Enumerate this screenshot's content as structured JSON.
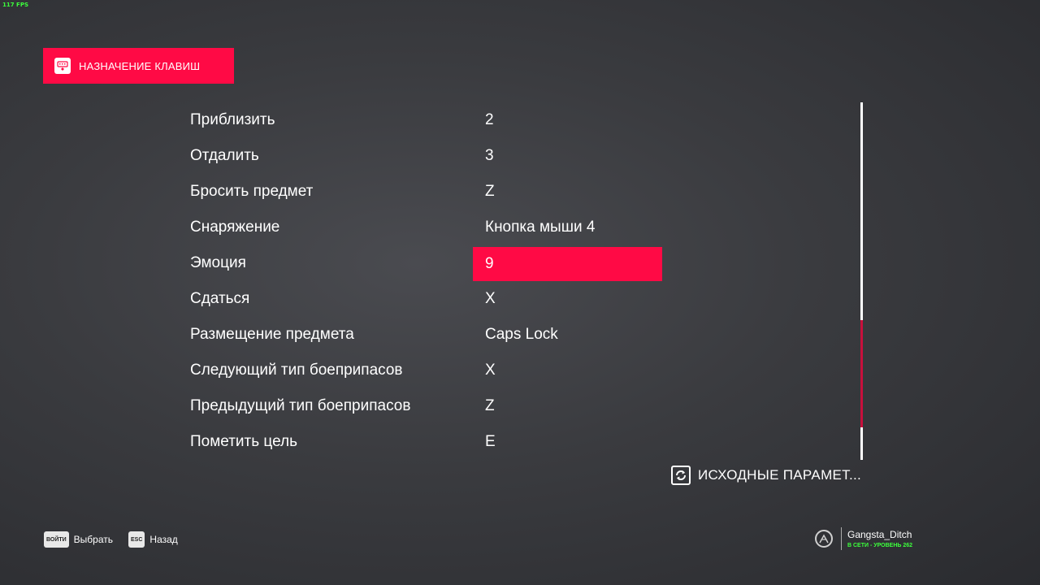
{
  "fps": "117 FPS",
  "header": {
    "title": "НАЗНАЧЕНИЕ КЛАВИШ",
    "icon": "keyboard-icon"
  },
  "bindings": [
    {
      "action": "Приблизить",
      "key": "2"
    },
    {
      "action": "Отдалить",
      "key": "3"
    },
    {
      "action": "Бросить предмет",
      "key": "Z"
    },
    {
      "action": "Снаряжение",
      "key": "Кнопка мыши 4"
    },
    {
      "action": "Эмоция",
      "key": "9",
      "selected": true
    },
    {
      "action": "Сдаться",
      "key": "X"
    },
    {
      "action": "Размещение предмета",
      "key": "Caps Lock"
    },
    {
      "action": "Следующий тип боеприпасов",
      "key": "X"
    },
    {
      "action": "Предыдущий тип боеприпасов",
      "key": "Z"
    },
    {
      "action": "Пометить цель",
      "key": "E"
    }
  ],
  "scrollbar": {
    "thumb_start": 0.61,
    "thumb_end": 0.91
  },
  "reset": {
    "label": "ИСХОДНЫЕ ПАРАМЕТ...",
    "icon": "reset-icon"
  },
  "hints": [
    {
      "badge": "ВОЙТИ",
      "label": "Выбрать"
    },
    {
      "badge": "ESC",
      "label": "Назад"
    }
  ],
  "profile": {
    "name": "Gangsta_Ditch",
    "status": "В СЕТИ - УРОВЕНЬ 262",
    "icon": "player-emblem-icon"
  },
  "colors": {
    "accent": "#ff0a45",
    "status": "#3cff3c"
  }
}
